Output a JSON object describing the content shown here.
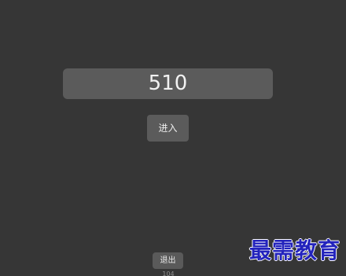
{
  "main": {
    "value": "510",
    "enter_label": "进入"
  },
  "footer": {
    "exit_label": "退出",
    "small_text": "104"
  },
  "watermark": {
    "text": "最需教育"
  },
  "colors": {
    "background": "#363636",
    "control": "#5b5b5b",
    "watermark": "#2323bc"
  }
}
